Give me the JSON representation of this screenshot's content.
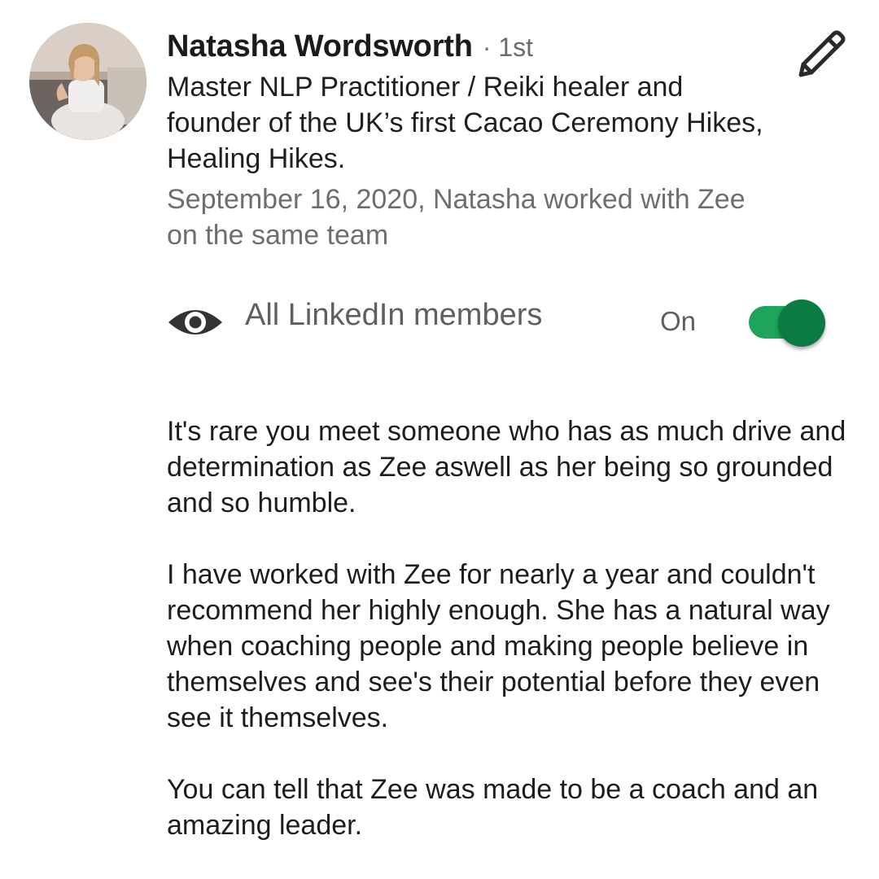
{
  "recommender": {
    "name": "Natasha Wordsworth",
    "connection_degree": "· 1st",
    "headline": "Master NLP Practitioner / Reiki healer and founder of the UK’s first Cacao Ceremony Hikes, Healing Hikes.",
    "relationship": "September 16, 2020, Natasha worked with Zee on the same team",
    "avatar_icon": "profile-photo"
  },
  "actions": {
    "edit_icon": "pencil-icon"
  },
  "visibility": {
    "icon": "eye-icon",
    "label": "All LinkedIn members",
    "state_label": "On",
    "toggle_on": true,
    "accent_color": "#1ea45b",
    "knob_color": "#0b7a43"
  },
  "recommendation": {
    "paragraphs": [
      "It's rare you meet someone who has as much drive and determination as Zee aswell as her being so grounded and so humble.",
      "I have worked with Zee for nearly a year and couldn't recommend her highly enough. She has a natural way when coaching people and making people believe in themselves and see's their potential before they even see it themselves.",
      "You can tell that Zee was made to be a coach and an amazing leader."
    ]
  }
}
